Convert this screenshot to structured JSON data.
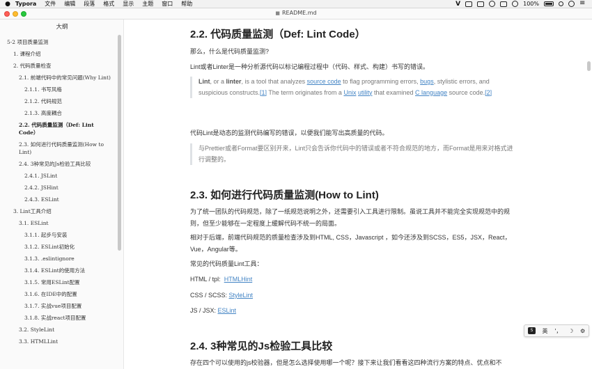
{
  "menubar": {
    "app_name": "Typora",
    "items": [
      "文件",
      "编辑",
      "段落",
      "格式",
      "显示",
      "主题",
      "窗口",
      "帮助"
    ],
    "battery": "100%"
  },
  "window": {
    "title": "README.md"
  },
  "sidebar": {
    "title": "大纲",
    "items": [
      {
        "label": "5-2 项目质量监测",
        "level": 0
      },
      {
        "label": "1. 课程介绍",
        "level": 1
      },
      {
        "label": "2. 代码质量检查",
        "level": 1
      },
      {
        "label": "2.1. 前端代码中的常见问题(Why Lint)",
        "level": 2
      },
      {
        "label": "2.1.1. 书写风格",
        "level": 3
      },
      {
        "label": "2.1.2. 代码规范",
        "level": 3
      },
      {
        "label": "2.1.3. 高度耦合",
        "level": 3
      },
      {
        "label": "2.2. 代码质量监测（Def: Lint Code）",
        "level": 2,
        "active": true
      },
      {
        "label": "2.3. 如何进行代码质量监测(How to Lint)",
        "level": 2
      },
      {
        "label": "2.4. 3种常见的Js检验工具比较",
        "level": 2
      },
      {
        "label": "2.4.1. JSLint",
        "level": 3
      },
      {
        "label": "2.4.2. JSHint",
        "level": 3
      },
      {
        "label": "2.4.3. ESLint",
        "level": 3
      },
      {
        "label": "3. Lint工具介绍",
        "level": 1
      },
      {
        "label": "3.1. ESLint",
        "level": 2
      },
      {
        "label": "3.1.1. 起步与安装",
        "level": 3
      },
      {
        "label": "3.1.2. ESLint初始化",
        "level": 3
      },
      {
        "label": "3.1.3. .eslintignore",
        "level": 3
      },
      {
        "label": "3.1.4. ESLint的使用方法",
        "level": 3
      },
      {
        "label": "3.1.5. 常用ESLint配置",
        "level": 3
      },
      {
        "label": "3.1.6. 在IDE中的配置",
        "level": 3
      },
      {
        "label": "3.1.7. 实战vue项目配置",
        "level": 3
      },
      {
        "label": "3.1.8. 实战react项目配置",
        "level": 3
      },
      {
        "label": "3.2. StyleLint",
        "level": 2
      },
      {
        "label": "3.3. HTMLLint",
        "level": 2
      }
    ]
  },
  "content": {
    "h_22": "2.2. 代码质量监测（Def: Lint Code）",
    "p_what": "那么，什么是代码质量监测?",
    "p_lint_def": "Lint或者Linter是一种分析源代码以标记编程过程中（代码、样式、构建）书写的错误。",
    "quote1": {
      "b1": "Lint",
      "t1": ", or a ",
      "b2": "linter",
      "t2": ", is a tool that analyzes ",
      "l1": "source code",
      "t3": " to flag programming errors, ",
      "l2": "bugs",
      "t4": ", stylistic errors, and suspicious constructs.",
      "l3": "[1]",
      "t5": " The term originates from a ",
      "l4": "Unix",
      "t6": " ",
      "l5": "utility",
      "t7": " that examined ",
      "l6": "C language",
      "t8": " source code.",
      "l7": "[2]"
    },
    "p_lint_dyn": "代码Lint是动态的监测代码编写的错误，以便我们能写出高质量的代码。",
    "quote2": "与Prettier或者Format要区别开来，Lint只会告诉你代码中的错误或者不符合规范的地方，而Format是用来对格式进行调整的。",
    "h_23": "2.3. 如何进行代码质量监测(How to Lint)",
    "p_team": "为了统一团队的代码规范，除了一纸规范说明之外，还需要引入工具进行限制。虽说工具并不能完全实现规范中的规则，但至少能够在一定程度上缓解代码不统一的局面。",
    "p_front": "相对于后端，前端代码规范的质量检查涉及到HTML, CSS，Javascript ，如今还涉及到SCSS，ES5，JSX，React，Vue，Angular等。",
    "p_tools": "常见的代码质量Lint工具：",
    "tool_html_label": "HTML / tpl:",
    "tool_html_link": "HTMLHint",
    "tool_css_label": "CSS / SCSS:",
    "tool_css_link": "StyleLint",
    "tool_js_label": "JS / JSX:",
    "tool_js_link": "ESLint",
    "h_24": "2.4. 3种常见的Js检验工具比较",
    "p_four": "存在四个可以使用的js校验器，但是怎么选择使用哪一个呢？接下来让我们看看这四种流行方案的特点、优点和不"
  },
  "ime": {
    "logo": "S",
    "lang": "英",
    "punct": "'，",
    "moon": "☽",
    "gear": "⚙"
  }
}
